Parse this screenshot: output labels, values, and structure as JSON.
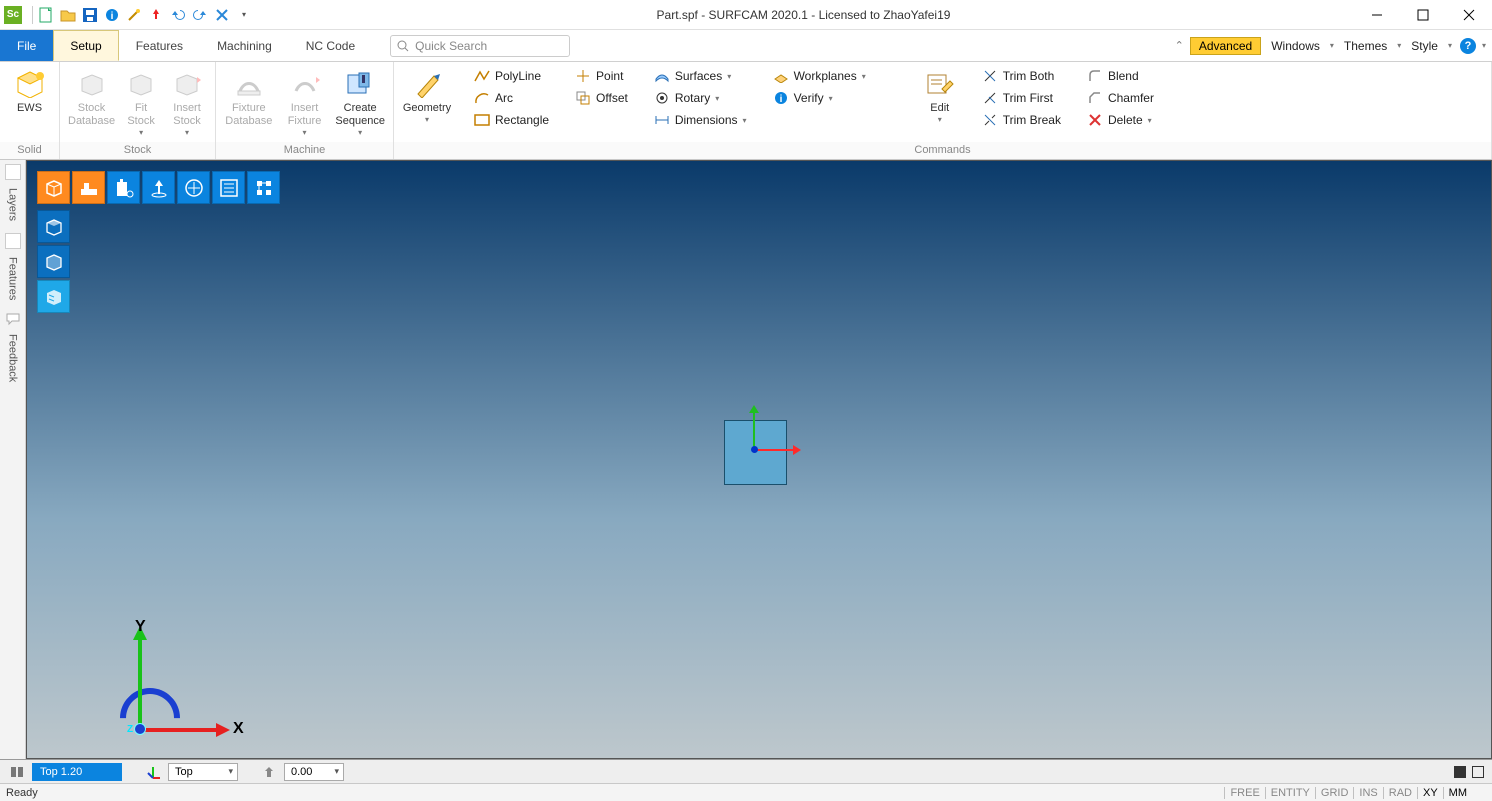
{
  "title": "Part.spf - SURFCAM 2020.1  - Licensed to ZhaoYafei19",
  "tabs": {
    "file": "File",
    "setup": "Setup",
    "features": "Features",
    "machining": "Machining",
    "nccode": "NC Code"
  },
  "search_placeholder": "Quick Search",
  "right_menus": {
    "advanced": "Advanced",
    "windows": "Windows",
    "themes": "Themes",
    "style": "Style"
  },
  "groups": {
    "solid": {
      "title": "Solid",
      "ews": "EWS"
    },
    "stock": {
      "title": "Stock",
      "db": "Stock\nDatabase",
      "fit": "Fit\nStock",
      "insert": "Insert\nStock"
    },
    "machine": {
      "title": "Machine",
      "fdb": "Fixture\nDatabase",
      "ifix": "Insert\nFixture",
      "seq": "Create\nSequence"
    },
    "commands": {
      "title": "Commands",
      "geometry": "Geometry",
      "polyline": "PolyLine",
      "arc": "Arc",
      "rectangle": "Rectangle",
      "point": "Point",
      "offset": "Offset",
      "surfaces": "Surfaces",
      "rotary": "Rotary",
      "dimensions": "Dimensions",
      "workplanes": "Workplanes",
      "verify": "Verify",
      "edit": "Edit",
      "trimboth": "Trim Both",
      "trimfirst": "Trim First",
      "trimbreak": "Trim Break",
      "blend": "Blend",
      "chamfer": "Chamfer",
      "delete": "Delete"
    }
  },
  "side": {
    "layers": "Layers",
    "features": "Features",
    "feedback": "Feedback"
  },
  "gnomon": {
    "x": "X",
    "y": "Y",
    "z": "Z"
  },
  "viewbar": {
    "chip": "Top 1.20",
    "view": "Top",
    "depth": "0.00"
  },
  "status": {
    "ready": "Ready",
    "free": "FREE",
    "entity": "ENTITY",
    "grid": "GRID",
    "ins": "INS",
    "rad": "RAD",
    "xy": "XY",
    "mm": "MM"
  }
}
